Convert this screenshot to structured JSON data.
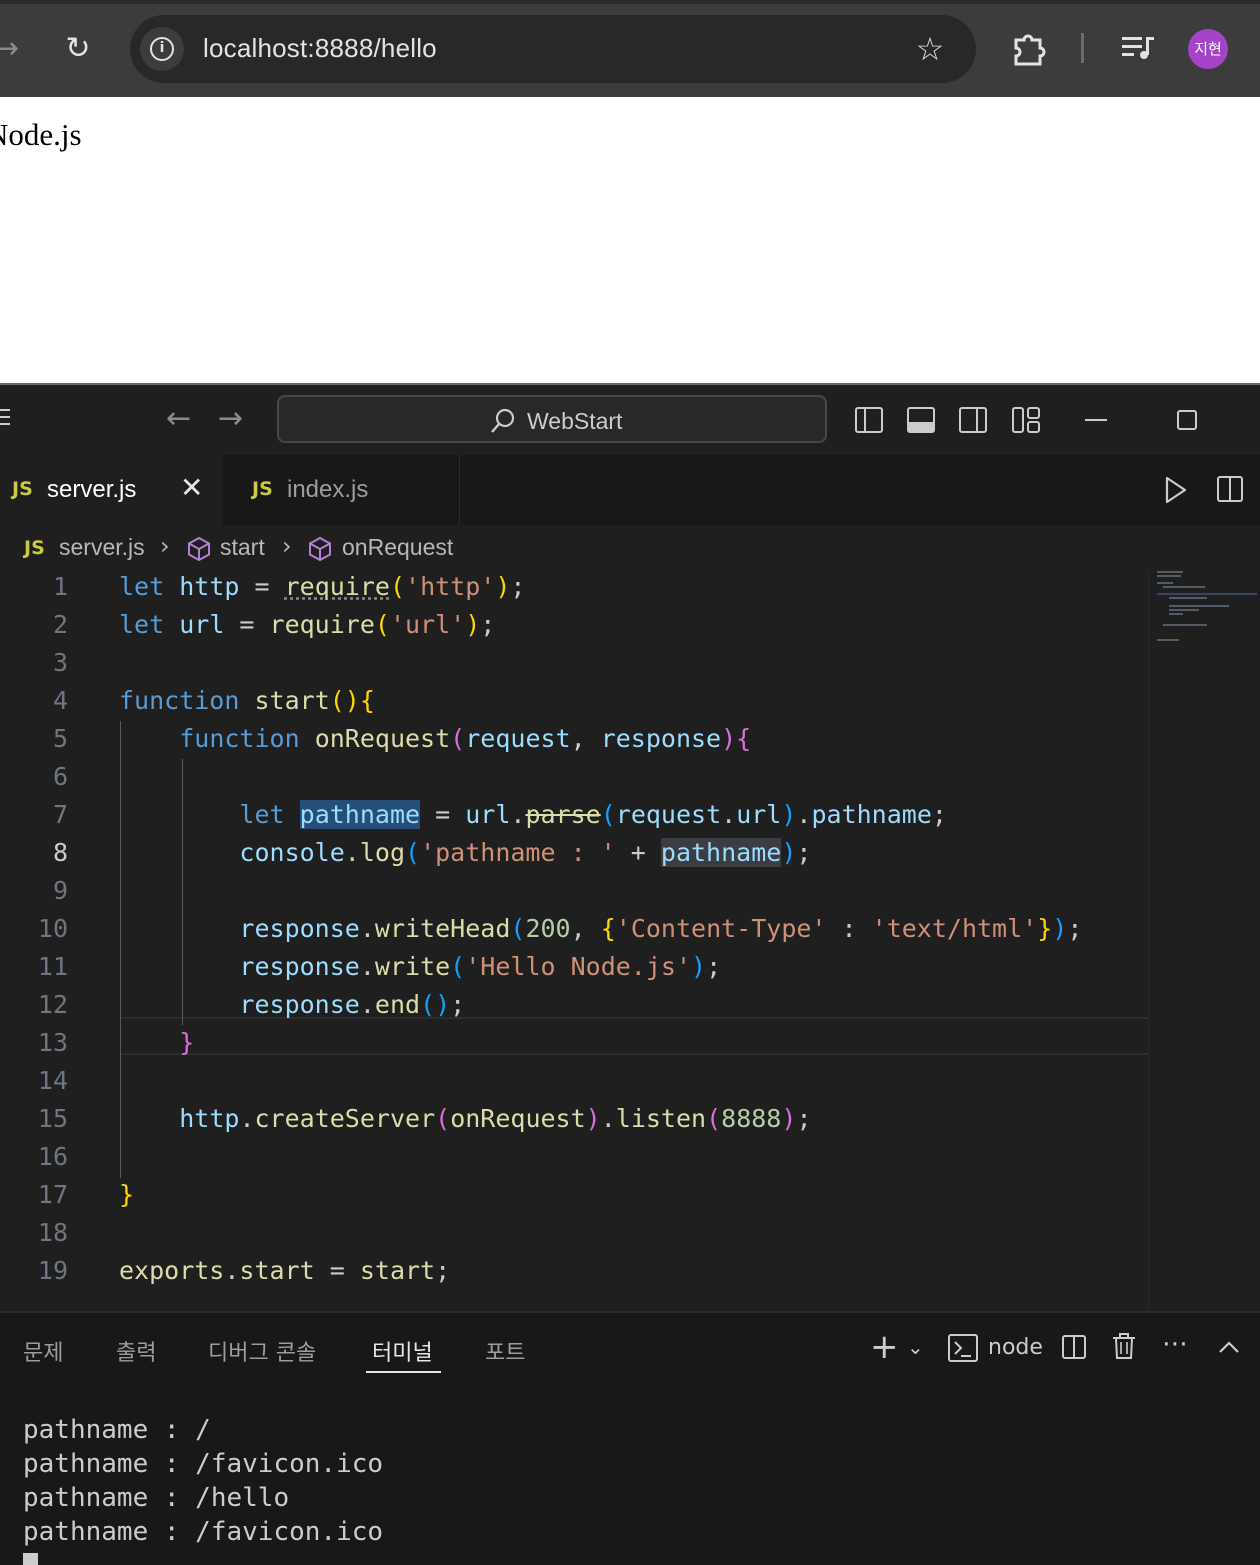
{
  "browser": {
    "url": "localhost:8888/hello",
    "profile_initials": "지현",
    "icons": [
      "forward-icon",
      "reload-icon",
      "site-info-icon",
      "bookmark-star-icon",
      "extensions-icon",
      "media-controls-icon"
    ],
    "colors": {
      "toolbar": "#3c3c3c",
      "omnibox": "#282828",
      "avatar": "#a445c7"
    }
  },
  "web_page": {
    "body_text": "Node.js"
  },
  "vscode": {
    "search_label": "WebStart",
    "tabs": [
      {
        "badge": "JS",
        "label": "server.js",
        "active": true
      },
      {
        "badge": "JS",
        "label": "index.js",
        "active": false
      }
    ],
    "breadcrumb": [
      "server.js",
      "start",
      "onRequest"
    ],
    "code": {
      "current_line": 8,
      "line_numbers": [
        "1",
        "2",
        "3",
        "4",
        "5",
        "6",
        "7",
        "8",
        "9",
        "10",
        "11",
        "12",
        "13",
        "14",
        "15",
        "16",
        "17",
        "18",
        "19"
      ],
      "lines": [
        "let http = require('http');",
        "let url = require('url');",
        "",
        "function start(){",
        "    function onRequest(request, response){",
        "",
        "        let pathname = url.parse(request.url).pathname;",
        "        console.log('pathname : ' + pathname);",
        "",
        "        response.writeHead(200, {'Content-Type' : 'text/html'});",
        "        response.write('Hello Node.js');",
        "        response.end();",
        "    }",
        "",
        "    http.createServer(onRequest).listen(8888);",
        "",
        "}",
        "",
        "exports.start = start;"
      ]
    },
    "panel": {
      "tabs": [
        "문제",
        "출력",
        "디버그 콘솔",
        "터미널",
        "포트"
      ],
      "active_tab": "터미널",
      "terminal_name": "node",
      "terminal_output": [
        "pathname : /",
        "pathname : /favicon.ico",
        "pathname : /hello",
        "pathname : /favicon.ico"
      ]
    },
    "colors": {
      "editor_bg": "#1f1f1f",
      "keyword": "#569cd6",
      "variable": "#9cdcfe",
      "function": "#dcdcaa",
      "string": "#ce9178",
      "number": "#b5cea8",
      "js_badge": "#cbcb41"
    }
  }
}
